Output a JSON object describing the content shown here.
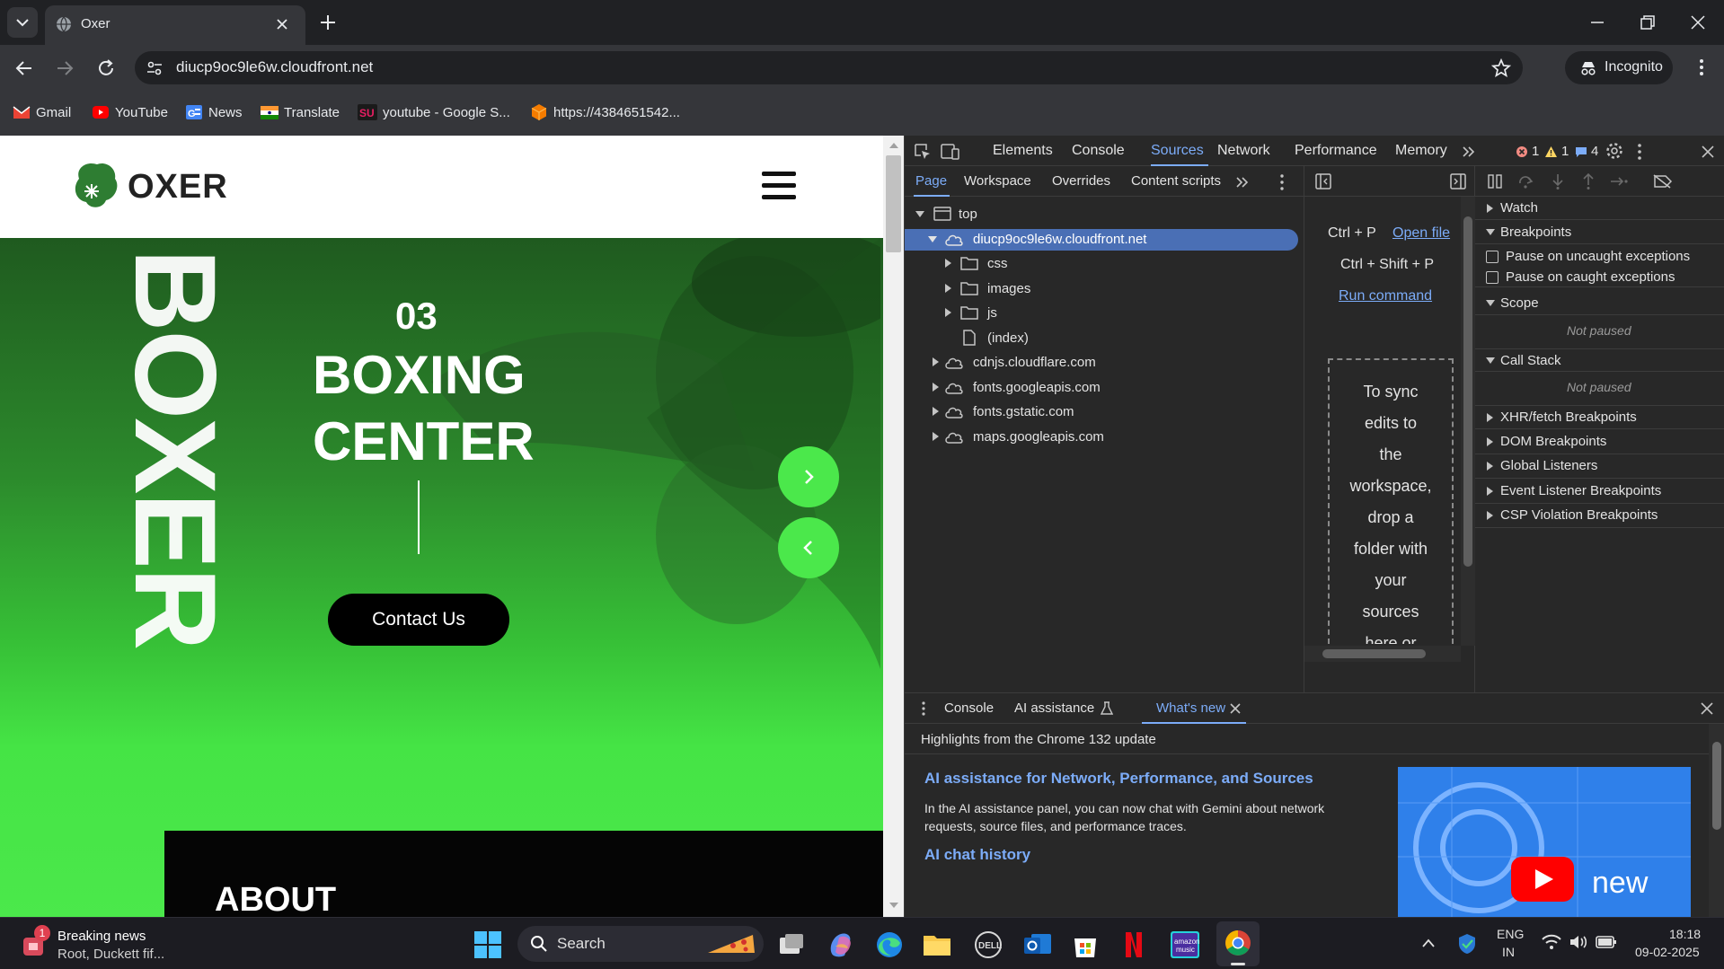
{
  "browser": {
    "tab_title": "Oxer",
    "url": "diucp9oc9le6w.cloudfront.net",
    "profile_label": "Incognito",
    "bookmarks": [
      {
        "label": "Gmail",
        "icon": "gmail-icon",
        "color": "#ea4335"
      },
      {
        "label": "YouTube",
        "icon": "youtube-icon",
        "color": "#ff0000"
      },
      {
        "label": "News",
        "icon": "news-icon",
        "color": "#4285f4"
      },
      {
        "label": "Translate",
        "icon": "india-flag-icon",
        "color": "#ff9933"
      },
      {
        "label": "youtube - Google S...",
        "icon": "su-icon",
        "color": "#c2185b"
      },
      {
        "label": "https://4384651542...",
        "icon": "box-icon",
        "color": "#f57c00"
      }
    ]
  },
  "site": {
    "logo_text": "OXER",
    "vertical_text": "BOXER",
    "slide_number": "03",
    "hero_title_line1": "BOXING",
    "hero_title_line2": "CENTER",
    "cta_label": "Contact Us",
    "about_heading": "ABOUT",
    "accent_color": "#4be84b"
  },
  "devtools": {
    "main_tabs": [
      "Elements",
      "Console",
      "Sources",
      "Network",
      "Performance",
      "Memory"
    ],
    "active_main_tab": "Sources",
    "error_count": "1",
    "warning_count": "1",
    "message_count": "4",
    "sources_subtabs": [
      "Page",
      "Workspace",
      "Overrides",
      "Content scripts"
    ],
    "tree": {
      "top": "top",
      "origin": "diucp9oc9le6w.cloudfront.net",
      "folders": [
        "css",
        "images",
        "js"
      ],
      "index": "(index)",
      "other_origins": [
        "cdnjs.cloudflare.com",
        "fonts.googleapis.com",
        "fonts.gstatic.com",
        "maps.googleapis.com"
      ]
    },
    "editor": {
      "shortcut1": "Ctrl + P",
      "shortcut1_action": "Open file",
      "shortcut2": "Ctrl + Shift + P",
      "shortcut2_action": "Run command",
      "drop_lines": [
        "To sync",
        "edits to",
        "the",
        "workspace,",
        "drop a",
        "folder with",
        "your",
        "sources",
        "here or"
      ]
    },
    "debugger": {
      "watch": "Watch",
      "breakpoints": "Breakpoints",
      "pause_uncaught": "Pause on uncaught exceptions",
      "pause_caught": "Pause on caught exceptions",
      "scope": "Scope",
      "not_paused": "Not paused",
      "call_stack": "Call Stack",
      "sections": [
        "XHR/fetch Breakpoints",
        "DOM Breakpoints",
        "Global Listeners",
        "Event Listener Breakpoints",
        "CSP Violation Breakpoints"
      ]
    },
    "drawer": {
      "tabs": [
        "Console",
        "AI assistance",
        "What's new"
      ],
      "active_tab": "What's new",
      "header": "Highlights from the Chrome 132 update",
      "article_title": "AI assistance for Network, Performance, and Sources",
      "article_body_line1": "In the AI assistance panel, you can now chat with Gemini about network",
      "article_body_line2": "requests, source files, and performance traces.",
      "article2_title": "AI chat history",
      "thumb_label": "new"
    }
  },
  "taskbar": {
    "news_title": "Breaking news",
    "news_subtitle": "Root, Duckett fif...",
    "news_badge": "1",
    "search_label": "Search",
    "language": "ENG",
    "region": "IN",
    "time": "18:18",
    "date": "09-02-2025"
  }
}
